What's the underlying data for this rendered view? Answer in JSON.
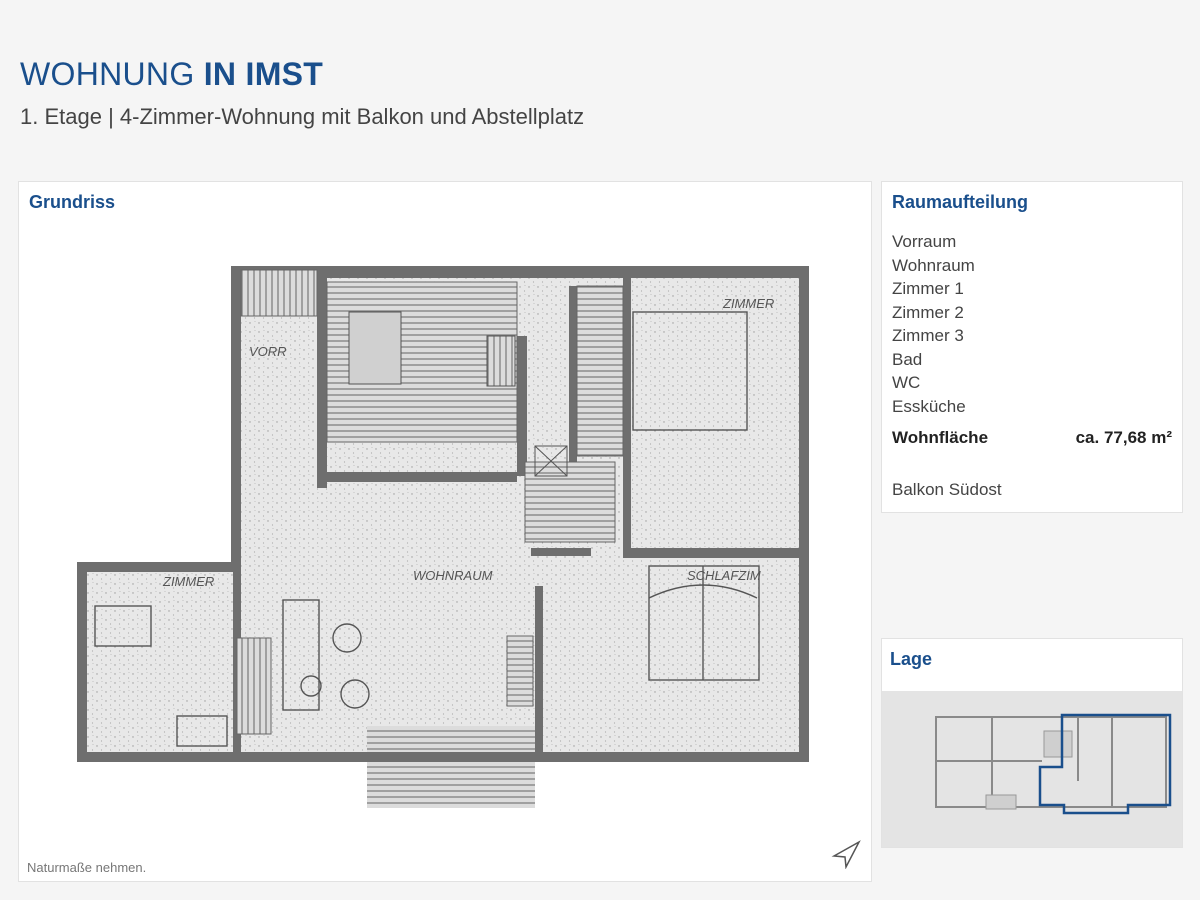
{
  "header": {
    "title_light": "WOHNUNG ",
    "title_bold": "IN IMST",
    "subtitle": "1. Etage | 4-Zimmer-Wohnung mit Balkon und Abstellplatz"
  },
  "plan": {
    "heading": "Grundriss",
    "note": "Naturmaße nehmen.",
    "labels": {
      "vorraum": "VORR",
      "zimmer_top": "ZIMMER",
      "zimmer_left": "ZIMMER",
      "wohnraum": "WOHNRAUM",
      "schlafzimmer": "SCHLAFZIM"
    }
  },
  "rooms": {
    "heading": "Raumaufteilung",
    "items": [
      "Vorraum",
      "Wohnraum",
      "Zimmer 1",
      "Zimmer 2",
      "Zimmer 3",
      "Bad",
      "WC",
      "Essküche"
    ],
    "area_label": "Wohnfläche",
    "area_value": "ca. 77,68 m²",
    "balcony": "Balkon Südost"
  },
  "location": {
    "heading": "Lage"
  },
  "colors": {
    "accent": "#1a4f8c",
    "floor": "#e7e7e7",
    "wall": "#6e6e6e"
  }
}
